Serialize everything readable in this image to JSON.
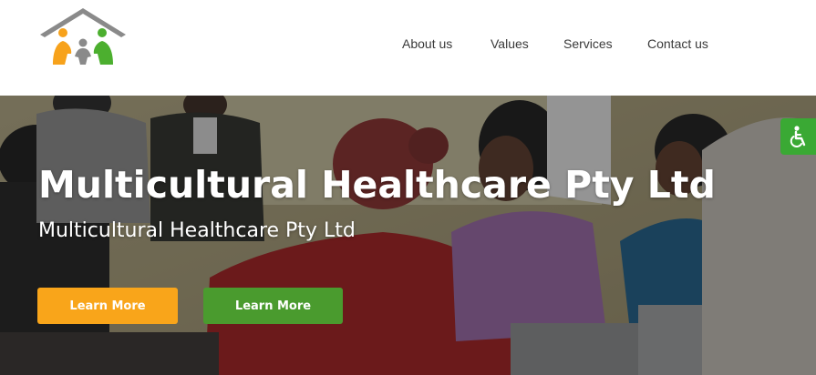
{
  "nav": {
    "items": [
      {
        "label": "About us"
      },
      {
        "label": "Values"
      },
      {
        "label": "Services"
      },
      {
        "label": "Contact us"
      }
    ]
  },
  "hero": {
    "title": "Multicultural Healthcare Pty Ltd",
    "subtitle": "Multicultural Healthcare Pty Ltd",
    "buttons": [
      {
        "label": "Learn More",
        "color": "#f9a51a"
      },
      {
        "label": "Learn More",
        "color": "#4a9b2e"
      }
    ]
  },
  "accessibility": {
    "icon": "wheelchair-icon",
    "color": "#3aa934"
  },
  "logo": {
    "icon": "family-house-icon",
    "colors": [
      "#f7a21b",
      "#8a8a8a",
      "#4caf2f"
    ]
  }
}
